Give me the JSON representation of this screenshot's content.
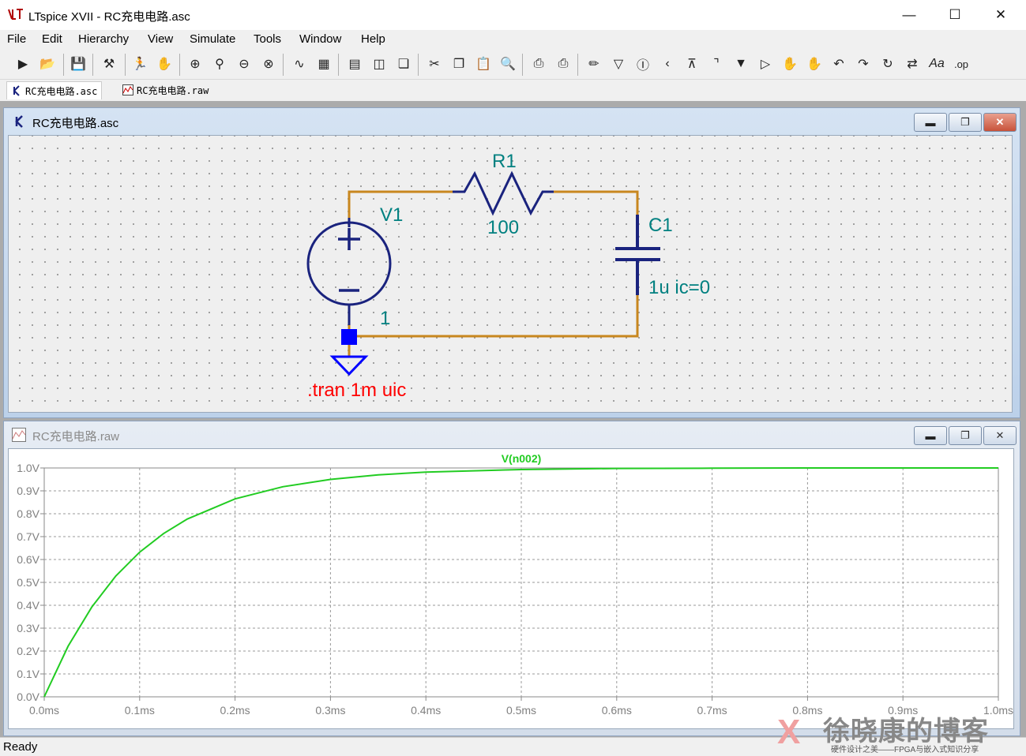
{
  "window": {
    "title": "LTspice XVII - RC充电电路.asc"
  },
  "menu": [
    "File",
    "Edit",
    "Hierarchy",
    "View",
    "Simulate",
    "Tools",
    "Window",
    "Help"
  ],
  "toolbar_icons": [
    "run-icon",
    "open-icon",
    "save-icon",
    "control-panel-icon",
    "run-figure-icon",
    "pan-hand-icon",
    "zoom-in-icon",
    "zoom-area-icon",
    "zoom-out-icon",
    "zoom-cancel-icon",
    "autorange-icon",
    "mark-icon",
    "tile-h-icon",
    "tile-v-icon",
    "cascade-icon",
    "cut-icon",
    "copy-icon",
    "paste-icon",
    "find-icon",
    "print-icon",
    "print-setup-icon",
    "draw-wire-icon",
    "ground-icon",
    "label-icon",
    "resistor-icon",
    "capacitor-icon",
    "inductor-icon",
    "diode-icon",
    "component-icon",
    "move-icon",
    "drag-icon",
    "undo-icon",
    "redo-icon",
    "rotate-icon",
    "mirror-icon",
    "text-icon",
    "spice-directive-icon"
  ],
  "tabs": [
    {
      "label": "RC充电电路.asc",
      "icon": "schematic-icon"
    },
    {
      "label": "RC充电电路.raw",
      "icon": "waveform-icon"
    }
  ],
  "schematic": {
    "title": "RC充电电路.asc",
    "r_name": "R1",
    "r_value": "100",
    "c_name": "C1",
    "c_value": "1u ic=0",
    "v_name": "V1",
    "v_value": "1",
    "directive": ".tran 1m uic",
    "colors": {
      "wire": "#c8871f",
      "component": "#1a237e",
      "label": "#008080",
      "directive": "#ff0000",
      "node": "#0000ff"
    }
  },
  "plot_window": {
    "title": "RC充电电路.raw"
  },
  "chart_data": {
    "type": "line",
    "title": "",
    "xlabel": "",
    "ylabel": "",
    "x_ticks": [
      "0.0ms",
      "0.1ms",
      "0.2ms",
      "0.3ms",
      "0.4ms",
      "0.5ms",
      "0.6ms",
      "0.7ms",
      "0.8ms",
      "0.9ms",
      "1.0ms"
    ],
    "y_ticks": [
      "0.0V",
      "0.1V",
      "0.2V",
      "0.3V",
      "0.4V",
      "0.5V",
      "0.6V",
      "0.7V",
      "0.8V",
      "0.9V",
      "1.0V"
    ],
    "xlim": [
      0,
      1.0
    ],
    "ylim": [
      0,
      1.0
    ],
    "x_unit": "ms",
    "grid": true,
    "series": [
      {
        "name": "V(n002)",
        "color": "#22cc22",
        "x": [
          0,
          0.025,
          0.05,
          0.075,
          0.1,
          0.125,
          0.15,
          0.2,
          0.25,
          0.3,
          0.35,
          0.4,
          0.5,
          0.6,
          0.7,
          0.8,
          0.9,
          1.0
        ],
        "y": [
          0,
          0.221,
          0.393,
          0.528,
          0.632,
          0.713,
          0.777,
          0.865,
          0.918,
          0.95,
          0.97,
          0.982,
          0.993,
          0.998,
          0.999,
          1.0,
          1.0,
          1.0
        ]
      }
    ]
  },
  "status": "Ready",
  "watermark": {
    "title": "徐晓康的博客",
    "subtitle": "硬件设计之美——FPGA与嵌入式知识分享"
  }
}
